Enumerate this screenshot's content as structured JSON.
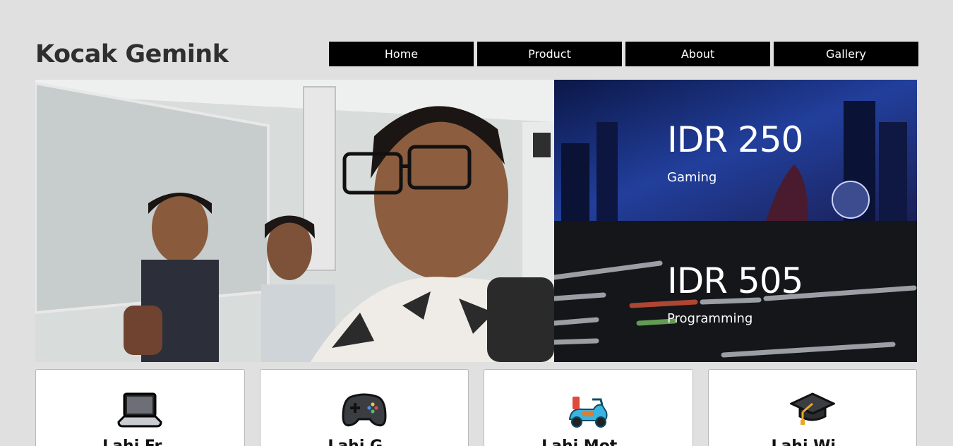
{
  "header": {
    "brand": "Kocak Gemink",
    "nav": [
      "Home",
      "Product",
      "About",
      "Gallery"
    ]
  },
  "hero": {
    "image_desc": "Selfie photo of three students in a classroom"
  },
  "promos": [
    {
      "price": "IDR 250",
      "label": "Gaming"
    },
    {
      "price": "IDR 505",
      "label": "Programming"
    }
  ],
  "cards": [
    {
      "icon": "laptop-icon",
      "title": "Lahi Fr..."
    },
    {
      "icon": "gamepad-icon",
      "title": "Lahi G..."
    },
    {
      "icon": "scooter-icon",
      "title": "Lahi Mot..."
    },
    {
      "icon": "graduation-cap-icon",
      "title": "Lahi Wi..."
    }
  ]
}
